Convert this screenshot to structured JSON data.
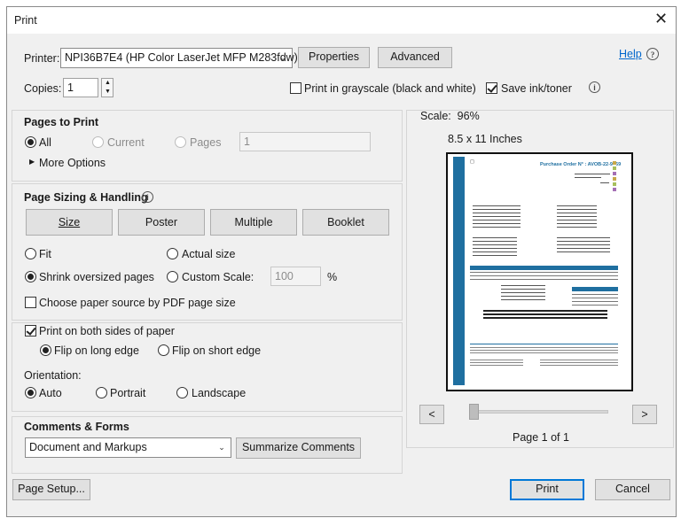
{
  "dialog": {
    "title": "Print"
  },
  "printer": {
    "label": "Printer:",
    "selected": "NPI36B7E4 (HP Color LaserJet MFP M283fdw)",
    "properties_label": "Properties",
    "advanced_label": "Advanced",
    "help_label": "Help"
  },
  "copies": {
    "label": "Copies:",
    "value": "1"
  },
  "options": {
    "grayscale_label": "Print in grayscale (black and white)",
    "grayscale_checked": false,
    "save_ink_label": "Save ink/toner",
    "save_ink_checked": true
  },
  "pages_to_print": {
    "title": "Pages to Print",
    "all_label": "All",
    "current_label": "Current",
    "pages_label": "Pages",
    "pages_value": "1",
    "more_options_label": "More Options",
    "selected": "All"
  },
  "page_sizing": {
    "title": "Page Sizing & Handling",
    "size_label": "Size",
    "poster_label": "Poster",
    "multiple_label": "Multiple",
    "booklet_label": "Booklet",
    "fit_label": "Fit",
    "actual_size_label": "Actual size",
    "shrink_label": "Shrink oversized pages",
    "custom_scale_label": "Custom Scale:",
    "custom_scale_value": "100",
    "percent": "%",
    "paper_source_label": "Choose paper source by PDF page size",
    "selected": "Shrink oversized pages"
  },
  "duplex": {
    "both_sides_label": "Print on both sides of paper",
    "both_sides_checked": true,
    "long_edge_label": "Flip on long edge",
    "short_edge_label": "Flip on short edge",
    "selected": "Flip on long edge"
  },
  "orientation": {
    "label": "Orientation:",
    "auto_label": "Auto",
    "portrait_label": "Portrait",
    "landscape_label": "Landscape",
    "selected": "Auto"
  },
  "comments_forms": {
    "title": "Comments & Forms",
    "selected": "Document and Markups",
    "summarize_label": "Summarize Comments"
  },
  "preview": {
    "scale_text": "Scale:  96%",
    "paper_size": "8.5 x 11 Inches",
    "prev_label": "<",
    "next_label": ">",
    "page_indicator": "Page 1 of 1",
    "slider_level": 0,
    "doc_heading": "Purchase Order N° : AVOB-22-9669"
  },
  "footer": {
    "page_setup_label": "Page Setup...",
    "print_label": "Print",
    "cancel_label": "Cancel"
  },
  "colors": {
    "accent": "#0078d7",
    "doc_blue": "#1f6fa0",
    "link": "#0066cc"
  }
}
